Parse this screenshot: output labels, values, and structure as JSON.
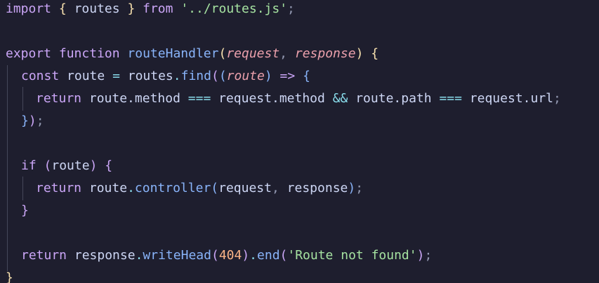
{
  "code": {
    "line1": {
      "import_kw": "import",
      "brace_open": "{",
      "name": "routes",
      "brace_close": "}",
      "from_kw": "from",
      "path": "'../routes.js'",
      "semi": ";"
    },
    "line3": {
      "export_kw": "export",
      "function_kw": "function",
      "fn_name": "routeHandler",
      "paren_open": "(",
      "param1": "request",
      "comma": ",",
      "param2": "response",
      "paren_close": ")",
      "brace_open": "{"
    },
    "line4": {
      "const_kw": "const",
      "var": "route",
      "eq": "=",
      "obj": "routes",
      "dot": ".",
      "method": "find",
      "paren_open": "(",
      "inner_paren_open": "(",
      "param": "route",
      "inner_paren_close": ")",
      "arrow": "=>",
      "brace_open": "{"
    },
    "line5": {
      "return_kw": "return",
      "a": "route.method",
      "eq1": "===",
      "b": "request.method",
      "and": "&&",
      "c": "route.path",
      "eq2": "===",
      "d": "request.url",
      "semi": ";"
    },
    "line6": {
      "brace_close": "}",
      "paren_close": ")",
      "semi": ";"
    },
    "line8": {
      "if_kw": "if",
      "paren_open": "(",
      "var": "route",
      "paren_close": ")",
      "brace_open": "{"
    },
    "line9": {
      "return_kw": "return",
      "obj": "route",
      "dot": ".",
      "method": "controller",
      "paren_open": "(",
      "arg1": "request",
      "comma": ",",
      "arg2": "response",
      "paren_close": ")",
      "semi": ";"
    },
    "line10": {
      "brace_close": "}"
    },
    "line12": {
      "return_kw": "return",
      "obj": "response",
      "dot1": ".",
      "method1": "writeHead",
      "paren_open1": "(",
      "status": "404",
      "paren_close1": ")",
      "dot2": ".",
      "method2": "end",
      "paren_open2": "(",
      "message": "'Route not found'",
      "paren_close2": ")",
      "semi": ";"
    },
    "line13": {
      "brace_close": "}"
    }
  }
}
